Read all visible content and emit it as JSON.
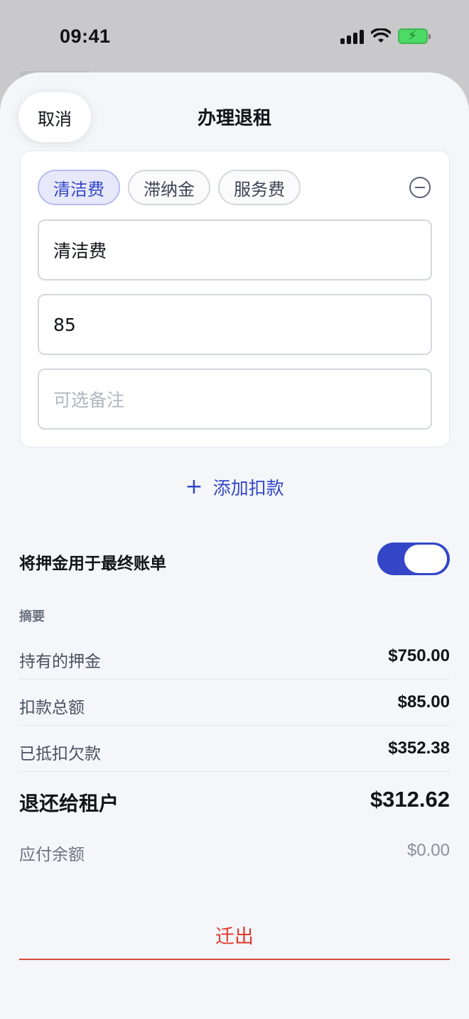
{
  "status_bar": {
    "time": "09:41"
  },
  "header": {
    "cancel_label": "取消",
    "title": "办理退租"
  },
  "deduction": {
    "chips": [
      {
        "label": "清洁费",
        "active": true
      },
      {
        "label": "滞纳金",
        "active": false
      },
      {
        "label": "服务费",
        "active": false
      }
    ],
    "name_value": "清洁费",
    "amount_value": "85",
    "note_placeholder": "可选备注"
  },
  "add_deduction_label": "添加扣款",
  "apply_deposit": {
    "label": "将押金用于最终账单",
    "enabled": true
  },
  "summary": {
    "heading": "摘要",
    "rows": [
      {
        "label": "持有的押金",
        "value": "$750.00"
      },
      {
        "label": "扣款总额",
        "value": "$85.00"
      },
      {
        "label": "已抵扣欠款",
        "value": "$352.38"
      }
    ],
    "refund": {
      "label": "退还给租户",
      "value": "$312.62"
    },
    "balance": {
      "label": "应付余额",
      "value": "$0.00"
    }
  },
  "move_out_label": "迁出",
  "colors": {
    "accent": "#3346c8",
    "danger": "#e0392f",
    "battery": "#4cd964"
  }
}
